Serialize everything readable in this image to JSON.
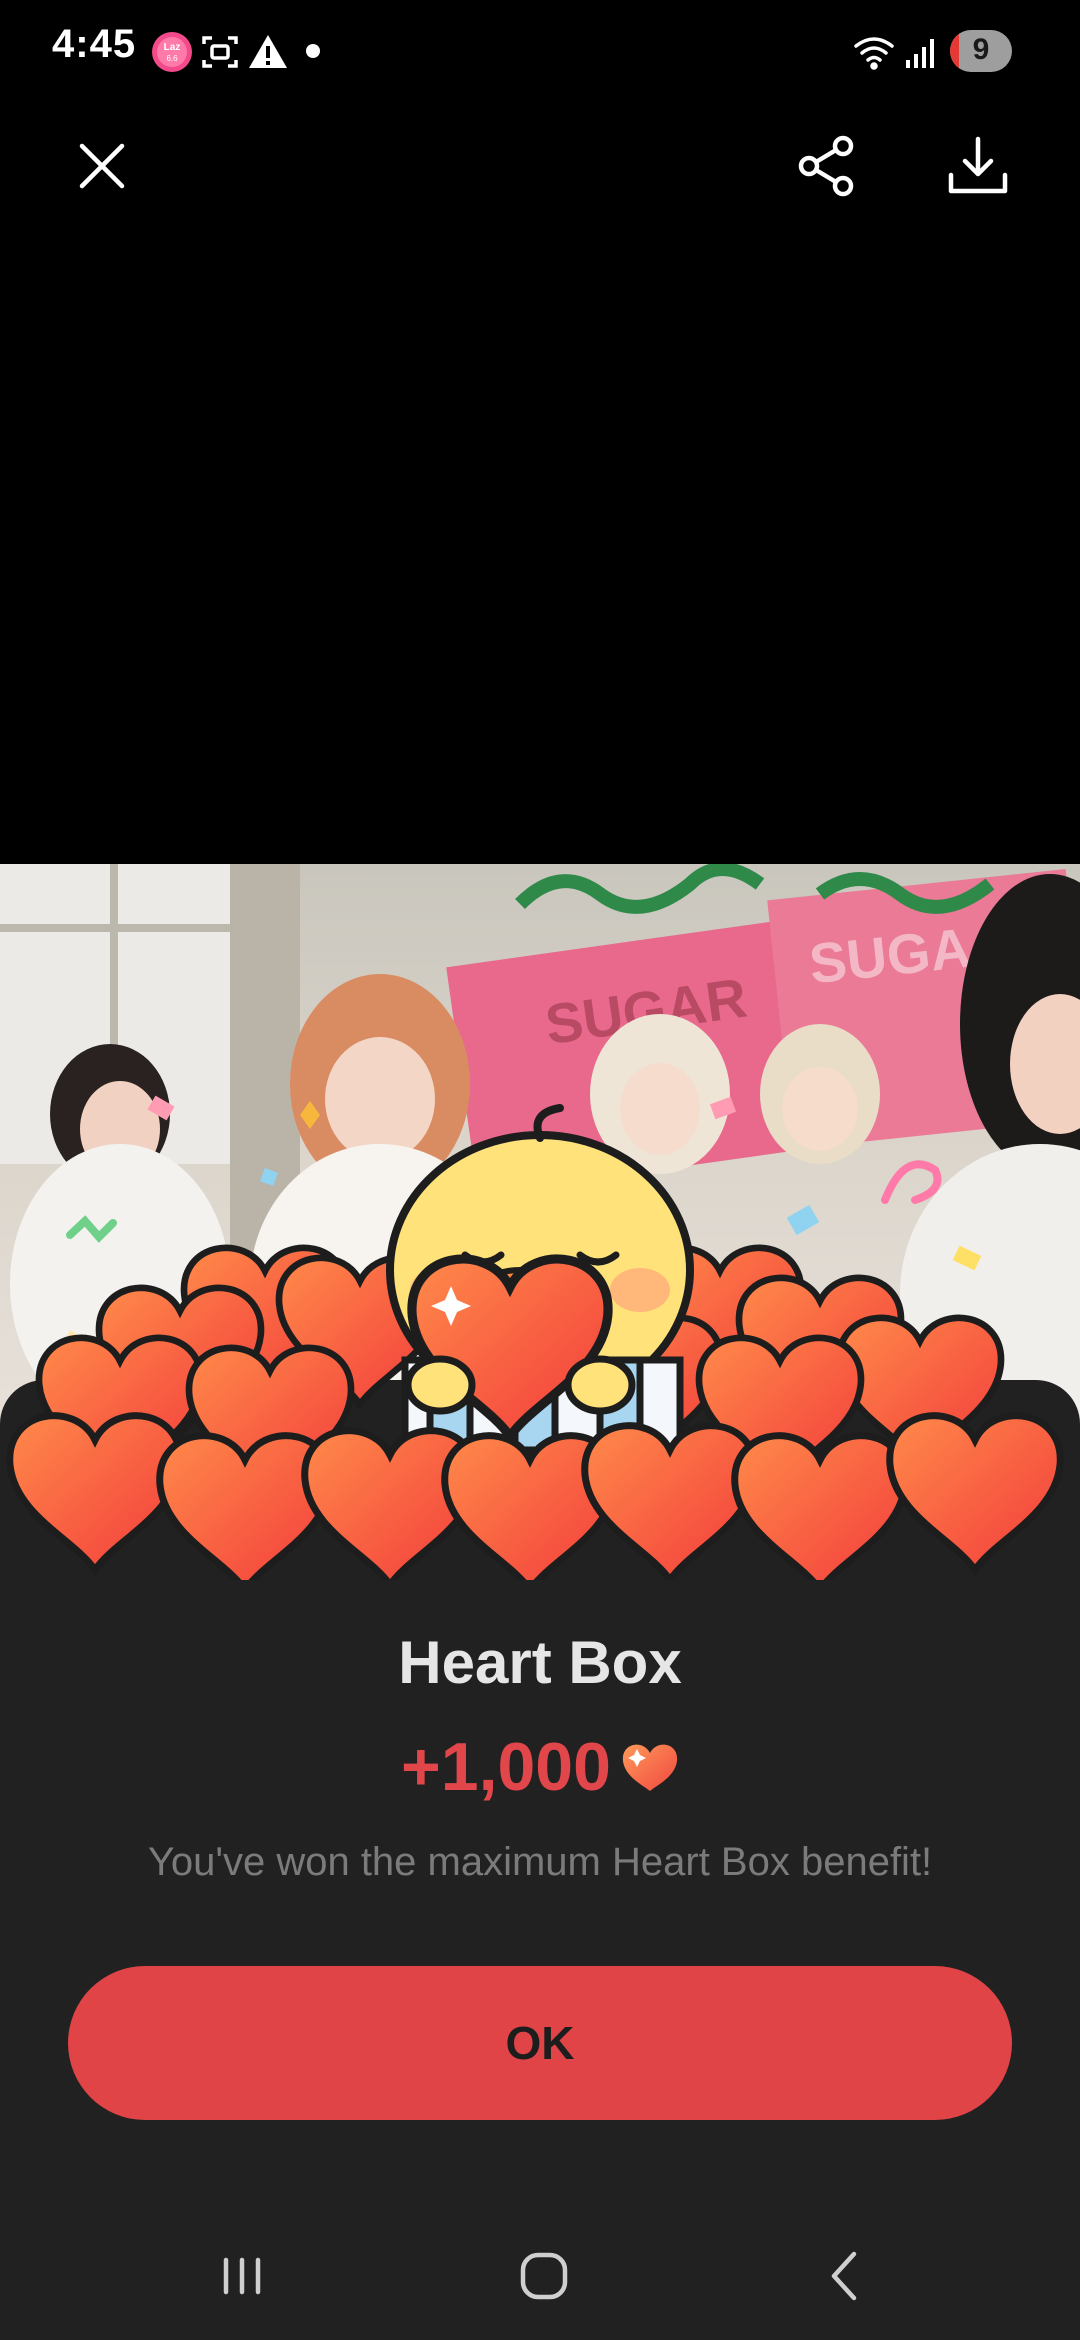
{
  "status_bar": {
    "time": "4:45",
    "app_badge": "Laz\n6.6",
    "battery_level": "9",
    "notification_icons": [
      "lazada-app-icon",
      "screenshot-icon",
      "warning-icon"
    ],
    "system_icons": [
      "wifi-icon",
      "signal-icon",
      "battery-icon"
    ]
  },
  "toolbar": {
    "close_icon": "close-icon",
    "share_icon": "share-icon",
    "download_icon": "download-icon"
  },
  "video": {
    "sign_text": "SUGAR"
  },
  "reward": {
    "title": "Heart Box",
    "amount": "+1,000",
    "message": "You've won the maximum Heart Box benefit!",
    "ok_label": "OK"
  },
  "nav_bar": {
    "recent_icon": "recent-apps-icon",
    "home_icon": "home-icon",
    "back_icon": "back-icon"
  },
  "colors": {
    "accent": "#e04446",
    "sheet_bg": "#212121",
    "heart": "#ff5a3c"
  }
}
